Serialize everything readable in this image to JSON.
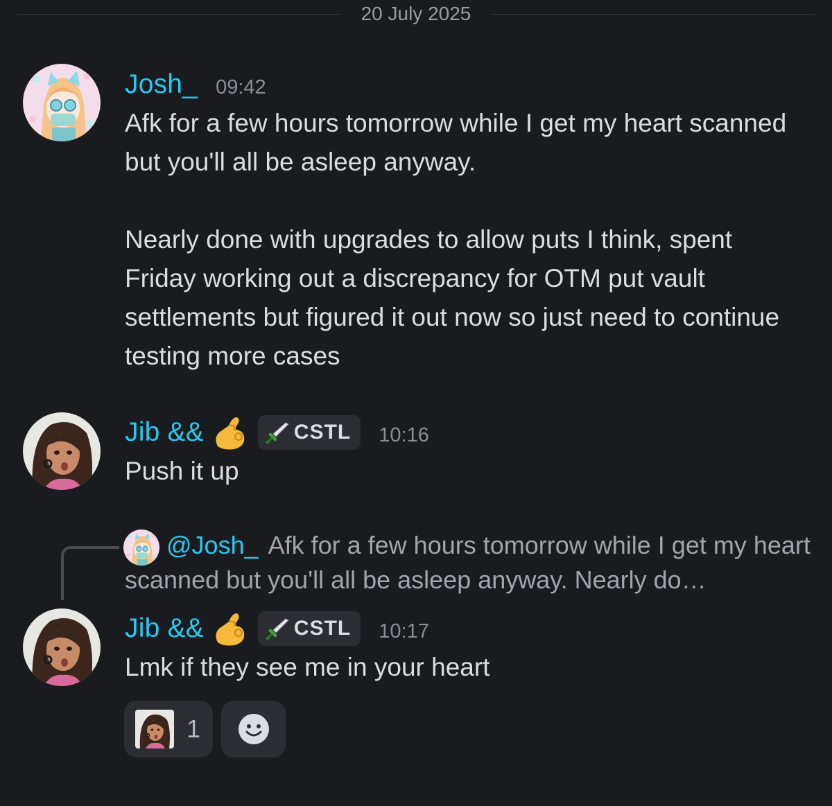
{
  "date_divider": "20 July 2025",
  "colors": {
    "background": "#1a1b1f",
    "username": "#26c9f1",
    "text": "#dcdde2",
    "muted": "#8c8e96",
    "chip": "#2b2d33"
  },
  "messages": [
    {
      "author": "Josh_",
      "time": "09:42",
      "avatar_icon": "josh-avatar-icon",
      "text": "Afk for a few hours tomorrow while I get my heart scanned but you'll all be asleep anyway.\n\nNearly done with upgrades to allow puts I think, spent Friday working out a discrepancy for OTM put vault settlements but figured it out now so just need to continue testing more cases"
    },
    {
      "author": "Jib &&",
      "author_emoji": "pinching-hand-emoji",
      "role": "CSTL",
      "role_icon": "sword-icon",
      "time": "10:16",
      "avatar_icon": "jib-avatar-icon",
      "text": "Push it up"
    },
    {
      "reply_to": {
        "mention": "@Josh_",
        "preview": "Afk for a few hours tomorrow while I get my heart scanned but you'll all be asleep anyway.   Nearly do…"
      },
      "author": "Jib &&",
      "author_emoji": "pinching-hand-emoji",
      "role": "CSTL",
      "role_icon": "sword-icon",
      "time": "10:17",
      "avatar_icon": "jib-avatar-icon",
      "text": "Lmk if they see me in your heart",
      "reactions": [
        {
          "icon": "custom-face-emoji",
          "count": "1"
        },
        {
          "icon": "add-reaction-smiley-icon"
        }
      ]
    }
  ]
}
